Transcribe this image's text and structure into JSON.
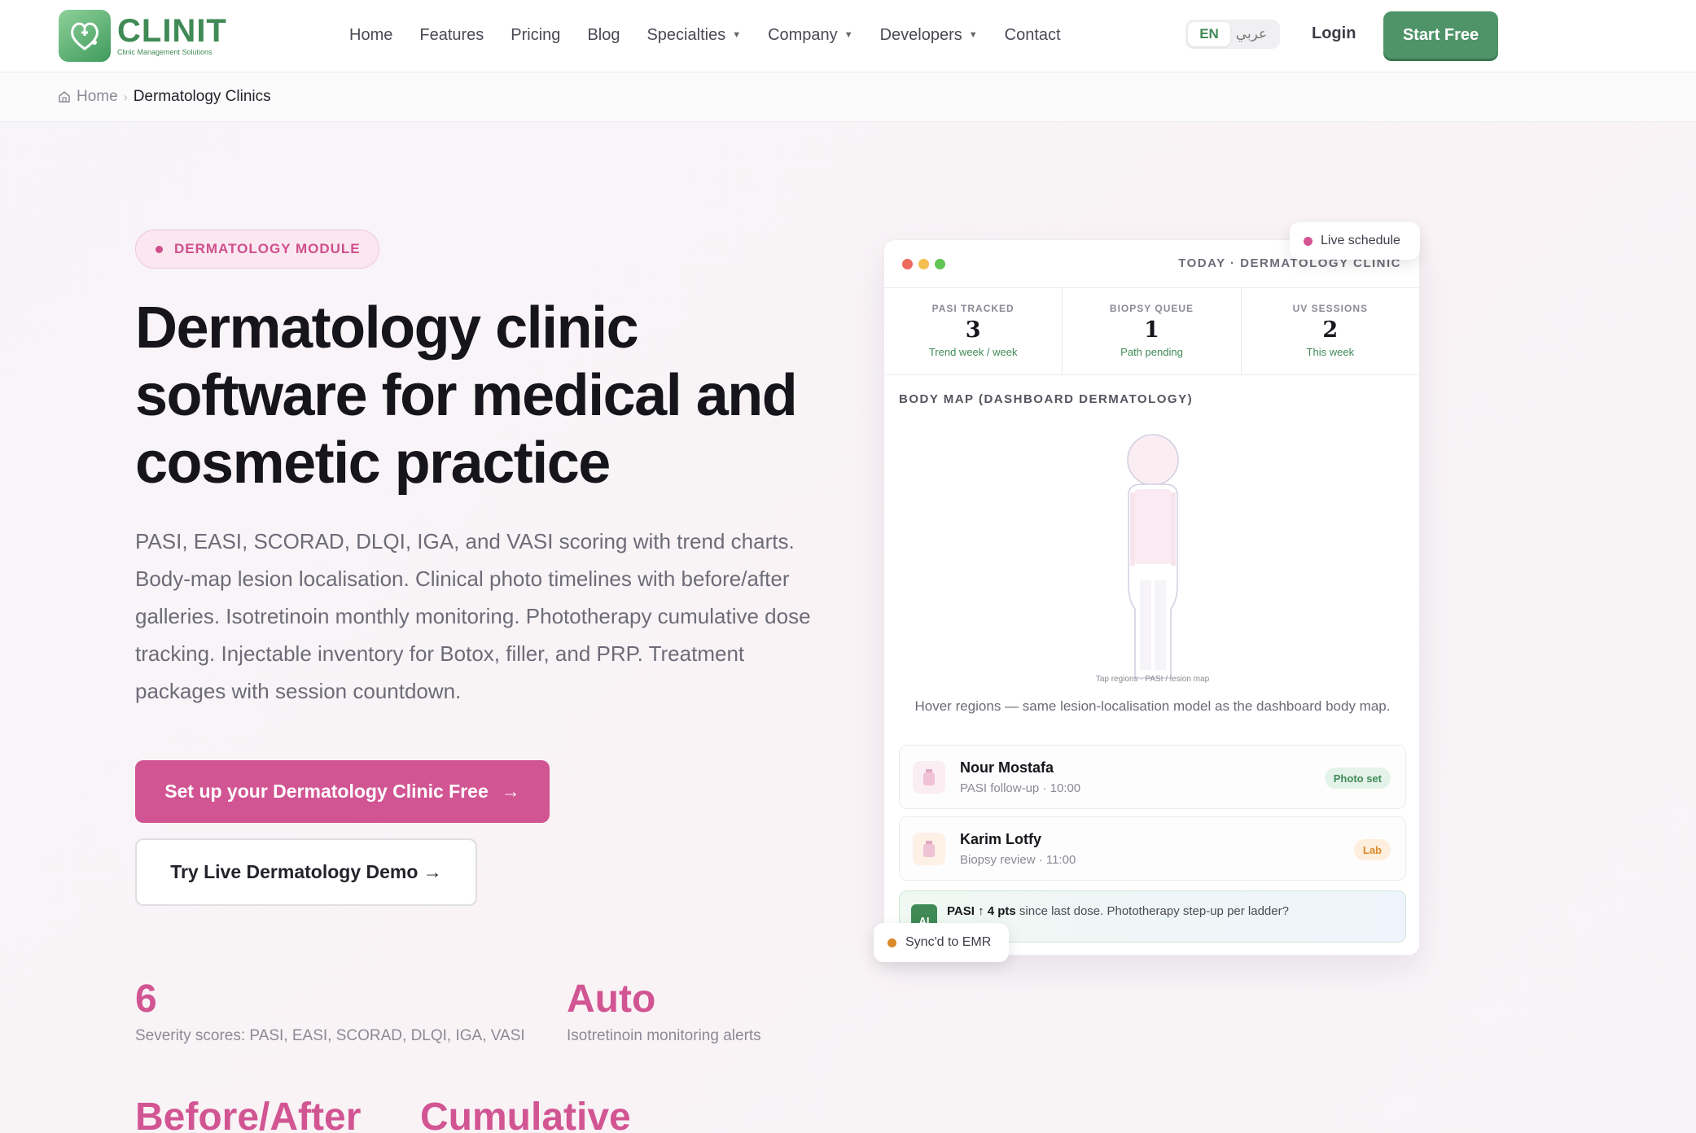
{
  "brand": {
    "name": "CLINIT",
    "tagline": "Clinic Management Solutions",
    "color": "#3f8a55"
  },
  "nav": {
    "links": [
      {
        "label": "Home"
      },
      {
        "label": "Features"
      },
      {
        "label": "Pricing"
      },
      {
        "label": "Blog"
      },
      {
        "label": "Specialties",
        "dropdown": true
      },
      {
        "label": "Company",
        "dropdown": true
      },
      {
        "label": "Developers",
        "dropdown": true
      },
      {
        "label": "Contact"
      }
    ],
    "caret": "▼",
    "lang": {
      "en": "EN",
      "ar": "عربي",
      "active": "EN"
    },
    "login": "Login",
    "start_free": "Start Free"
  },
  "breadcrumb": {
    "home": "Home",
    "separator": "›",
    "current": "Dermatology Clinics"
  },
  "hero": {
    "badge": "DERMATOLOGY MODULE",
    "title": "Dermatology clinic software for medical and cosmetic practice",
    "description": "PASI, EASI, SCORAD, DLQI, IGA, and VASI scoring with trend charts. Body-map lesion localisation. Clinical photo timelines with before/after galleries. Isotretinoin monthly monitoring. Phototherapy cumulative dose tracking. Injectable inventory for Botox, filler, and PRP. Treatment packages with session countdown.",
    "cta_primary": "Set up your Dermatology Clinic Free",
    "cta_primary_arrow": "→",
    "cta_secondary": "Try Live Dermatology Demo →",
    "accent": "#d25593"
  },
  "stats": [
    {
      "value": "6",
      "label": "Severity scores: PASI, EASI, SCORAD, DLQI, IGA, VASI"
    },
    {
      "value": "Auto",
      "label": "Isotretinoin monitoring alerts"
    },
    {
      "value": "Before/After",
      "label": ""
    },
    {
      "value": "Cumulative",
      "label": ""
    }
  ],
  "preview": {
    "header": "TODAY · DERMATOLOGY CLINIC",
    "live_badge": "Live schedule",
    "sync_badge": "Sync'd to EMR",
    "metrics": [
      {
        "label": "PASI TRACKED",
        "value": "3",
        "sub": "Trend week / week"
      },
      {
        "label": "BIOPSY QUEUE",
        "value": "1",
        "sub": "Path pending"
      },
      {
        "label": "UV SESSIONS",
        "value": "2",
        "sub": "This week"
      }
    ],
    "bodymap_title": "BODY MAP (DASHBOARD DERMATOLOGY)",
    "bodymap_hint": "Tap regions · PASI / lesion map",
    "bodymap_caption": "Hover regions — same lesion-localisation model as the dashboard body map.",
    "appointments": [
      {
        "name": "Nour Mostafa",
        "detail": "PASI follow-up · 10:00",
        "badge": "Photo set",
        "badge_color": "#3f8a55"
      },
      {
        "name": "Karim Lotfy",
        "detail": "Biopsy review · 11:00",
        "badge": "Lab",
        "badge_color": "#d98a2b"
      }
    ],
    "ai": {
      "badge": "AI",
      "highlight": "PASI ↑ 4 pts",
      "text": " since last dose. Phototherapy step-up per ladder?"
    }
  }
}
